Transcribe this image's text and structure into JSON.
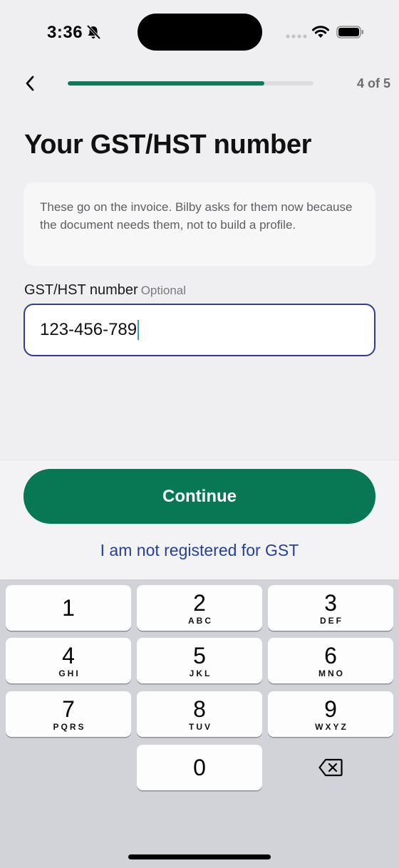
{
  "status_bar": {
    "time": "3:36"
  },
  "header": {
    "step_counter": "4 of 5",
    "progress_fraction": 0.8
  },
  "title": "Your GST/HST number",
  "info_text": "These go on the invoice. Bilby asks for them now because the document needs them, not to build a profile.",
  "field": {
    "label": "GST/HST number",
    "optional_label": "Optional",
    "value": "123-456-789"
  },
  "actions": {
    "continue_label": "Continue",
    "not_registered_label": "I am not registered for GST"
  },
  "keypad": {
    "keys": [
      {
        "digit": "1",
        "letters": ""
      },
      {
        "digit": "2",
        "letters": "ABC"
      },
      {
        "digit": "3",
        "letters": "DEF"
      },
      {
        "digit": "4",
        "letters": "GHI"
      },
      {
        "digit": "5",
        "letters": "JKL"
      },
      {
        "digit": "6",
        "letters": "MNO"
      },
      {
        "digit": "7",
        "letters": "PQRS"
      },
      {
        "digit": "8",
        "letters": "TUV"
      },
      {
        "digit": "9",
        "letters": "WXYZ"
      },
      {
        "digit": "0",
        "letters": ""
      }
    ]
  },
  "colors": {
    "accent": "#087754",
    "link": "#25409a",
    "input_border": "#2c3f91"
  },
  "icons": [
    "bell-slash-icon",
    "signal-icon",
    "wifi-icon",
    "battery-icon",
    "chevron-left-icon",
    "delete-icon"
  ]
}
